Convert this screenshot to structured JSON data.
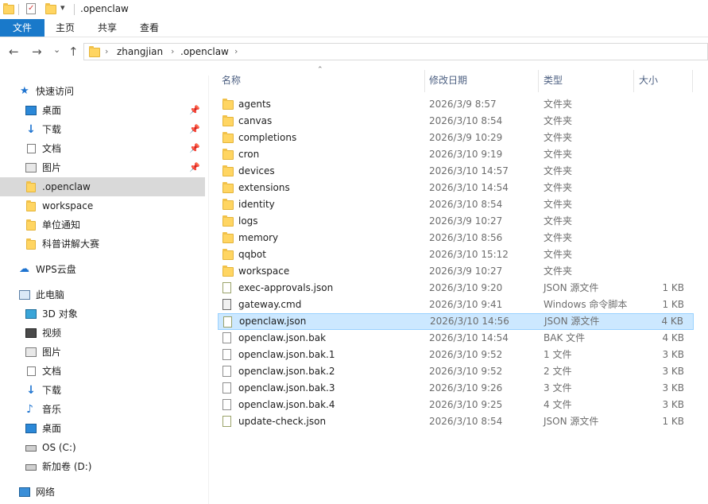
{
  "window": {
    "title": ".openclaw",
    "qat_dropdown_glyph": "▾"
  },
  "ribbon": {
    "tabs": [
      "文件",
      "主页",
      "共享",
      "查看"
    ],
    "expand_glyph": "⌄"
  },
  "nav": {
    "back_glyph": "←",
    "forward_glyph": "→",
    "recent_glyph": "⌄",
    "up_glyph": "↑",
    "breadcrumb": [
      "zhangjian",
      ".openclaw"
    ],
    "crumb_sep": "›"
  },
  "sidebar": {
    "quick_access": {
      "label": "快速访问",
      "icon": "star-icon",
      "items": [
        {
          "label": "桌面",
          "icon": "desktop-icon",
          "pinned": true
        },
        {
          "label": "下载",
          "icon": "download-icon",
          "pinned": true
        },
        {
          "label": "文档",
          "icon": "document-icon",
          "pinned": true
        },
        {
          "label": "图片",
          "icon": "pictures-icon",
          "pinned": true
        },
        {
          "label": ".openclaw",
          "icon": "folder-icon",
          "pinned": false,
          "selected": true
        },
        {
          "label": "workspace",
          "icon": "folder-icon",
          "pinned": false
        },
        {
          "label": "单位通知",
          "icon": "folder-icon",
          "pinned": false
        },
        {
          "label": "科普讲解大赛",
          "icon": "folder-icon",
          "pinned": false
        }
      ]
    },
    "wps": {
      "label": "WPS云盘",
      "icon": "cloud-icon"
    },
    "this_pc": {
      "label": "此电脑",
      "icon": "computer-icon",
      "items": [
        {
          "label": "3D 对象",
          "icon": "3d-objects-icon"
        },
        {
          "label": "视频",
          "icon": "video-icon"
        },
        {
          "label": "图片",
          "icon": "pictures-icon"
        },
        {
          "label": "文档",
          "icon": "document-icon"
        },
        {
          "label": "下载",
          "icon": "download-icon"
        },
        {
          "label": "音乐",
          "icon": "music-icon"
        },
        {
          "label": "桌面",
          "icon": "desktop-icon"
        },
        {
          "label": "OS (C:)",
          "icon": "drive-icon"
        },
        {
          "label": "新加卷 (D:)",
          "icon": "drive-icon"
        }
      ]
    },
    "network": {
      "label": "网络",
      "icon": "network-icon"
    },
    "pin_glyph": "📌"
  },
  "columns": {
    "name": "名称",
    "date": "修改日期",
    "type": "类型",
    "size": "大小",
    "sort_glyph": "⌃"
  },
  "files": [
    {
      "name": "agents",
      "date": "2026/3/9 8:57",
      "type": "文件夹",
      "size": "",
      "kind": "folder"
    },
    {
      "name": "canvas",
      "date": "2026/3/10 8:54",
      "type": "文件夹",
      "size": "",
      "kind": "folder"
    },
    {
      "name": "completions",
      "date": "2026/3/9 10:29",
      "type": "文件夹",
      "size": "",
      "kind": "folder"
    },
    {
      "name": "cron",
      "date": "2026/3/10 9:19",
      "type": "文件夹",
      "size": "",
      "kind": "folder"
    },
    {
      "name": "devices",
      "date": "2026/3/10 14:57",
      "type": "文件夹",
      "size": "",
      "kind": "folder"
    },
    {
      "name": "extensions",
      "date": "2026/3/10 14:54",
      "type": "文件夹",
      "size": "",
      "kind": "folder"
    },
    {
      "name": "identity",
      "date": "2026/3/10 8:54",
      "type": "文件夹",
      "size": "",
      "kind": "folder"
    },
    {
      "name": "logs",
      "date": "2026/3/9 10:27",
      "type": "文件夹",
      "size": "",
      "kind": "folder"
    },
    {
      "name": "memory",
      "date": "2026/3/10 8:56",
      "type": "文件夹",
      "size": "",
      "kind": "folder"
    },
    {
      "name": "qqbot",
      "date": "2026/3/10 15:12",
      "type": "文件夹",
      "size": "",
      "kind": "folder"
    },
    {
      "name": "workspace",
      "date": "2026/3/9 10:27",
      "type": "文件夹",
      "size": "",
      "kind": "folder"
    },
    {
      "name": "exec-approvals.json",
      "date": "2026/3/10 9:20",
      "type": "JSON 源文件",
      "size": "1 KB",
      "kind": "json"
    },
    {
      "name": "gateway.cmd",
      "date": "2026/3/10 9:41",
      "type": "Windows 命令脚本",
      "size": "1 KB",
      "kind": "cmd"
    },
    {
      "name": "openclaw.json",
      "date": "2026/3/10 14:56",
      "type": "JSON 源文件",
      "size": "4 KB",
      "kind": "json",
      "selected": true
    },
    {
      "name": "openclaw.json.bak",
      "date": "2026/3/10 14:54",
      "type": "BAK 文件",
      "size": "4 KB",
      "kind": "file"
    },
    {
      "name": "openclaw.json.bak.1",
      "date": "2026/3/10 9:52",
      "type": "1 文件",
      "size": "3 KB",
      "kind": "file"
    },
    {
      "name": "openclaw.json.bak.2",
      "date": "2026/3/10 9:52",
      "type": "2 文件",
      "size": "3 KB",
      "kind": "file"
    },
    {
      "name": "openclaw.json.bak.3",
      "date": "2026/3/10 9:26",
      "type": "3 文件",
      "size": "3 KB",
      "kind": "file"
    },
    {
      "name": "openclaw.json.bak.4",
      "date": "2026/3/10 9:25",
      "type": "4 文件",
      "size": "3 KB",
      "kind": "file"
    },
    {
      "name": "update-check.json",
      "date": "2026/3/10 8:54",
      "type": "JSON 源文件",
      "size": "1 KB",
      "kind": "json"
    }
  ],
  "colors": {
    "accent": "#1979ca",
    "selection": "#cce8ff",
    "sidebar_selection": "#d9d9d9",
    "folder": "#ffd562"
  }
}
